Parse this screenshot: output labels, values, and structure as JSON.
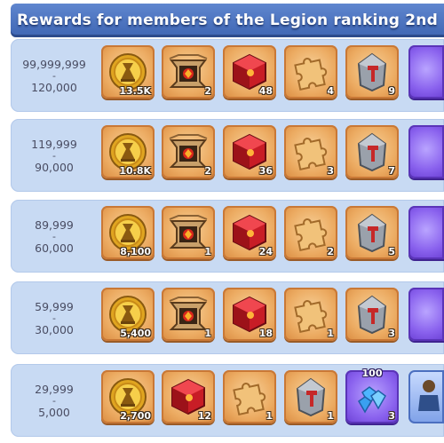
{
  "header": {
    "title": "Rewards for members of the Legion ranking 2nd"
  },
  "icons": {
    "coin": "gold-coin-icon",
    "frame": "ornate-frame-icon",
    "cube": "red-cube-icon",
    "puzzle": "puzzle-piece-icon",
    "stone": "hammer-rune-stone-icon",
    "gems": "blue-gems-icon"
  },
  "tiers": [
    {
      "range_high": "99,999,999",
      "dash": "-",
      "range_low": "120,000",
      "items": [
        {
          "icon": "coin",
          "qty": "13.5K"
        },
        {
          "icon": "frame",
          "qty": "2"
        },
        {
          "icon": "cube",
          "qty": "48"
        },
        {
          "icon": "puzzle",
          "qty": "4"
        },
        {
          "icon": "stone",
          "qty": "9"
        }
      ]
    },
    {
      "range_high": "119,999",
      "dash": "-",
      "range_low": "90,000",
      "items": [
        {
          "icon": "coin",
          "qty": "10.8K"
        },
        {
          "icon": "frame",
          "qty": "2"
        },
        {
          "icon": "cube",
          "qty": "36"
        },
        {
          "icon": "puzzle",
          "qty": "3"
        },
        {
          "icon": "stone",
          "qty": "7"
        }
      ]
    },
    {
      "range_high": "89,999",
      "dash": "-",
      "range_low": "60,000",
      "items": [
        {
          "icon": "coin",
          "qty": "8,100"
        },
        {
          "icon": "frame",
          "qty": "1"
        },
        {
          "icon": "cube",
          "qty": "24"
        },
        {
          "icon": "puzzle",
          "qty": "2"
        },
        {
          "icon": "stone",
          "qty": "5"
        }
      ]
    },
    {
      "range_high": "59,999",
      "dash": "-",
      "range_low": "30,000",
      "items": [
        {
          "icon": "coin",
          "qty": "5,400"
        },
        {
          "icon": "frame",
          "qty": "1"
        },
        {
          "icon": "cube",
          "qty": "18"
        },
        {
          "icon": "puzzle",
          "qty": "1"
        },
        {
          "icon": "stone",
          "qty": "3"
        }
      ]
    },
    {
      "range_high": "29,999",
      "dash": "-",
      "range_low": "5,000",
      "items": [
        {
          "icon": "coin",
          "qty": "2,700"
        },
        {
          "icon": "cube",
          "qty": "12"
        },
        {
          "icon": "puzzle",
          "qty": "1"
        },
        {
          "icon": "stone",
          "qty": "1"
        },
        {
          "icon": "gems",
          "qty": "3",
          "top_label": "100"
        }
      ]
    }
  ],
  "colors": {
    "header": "#4f76c1",
    "row": "#c8daf3",
    "slot_orange": "#ecab62",
    "slot_purple": "#8a62ee"
  }
}
